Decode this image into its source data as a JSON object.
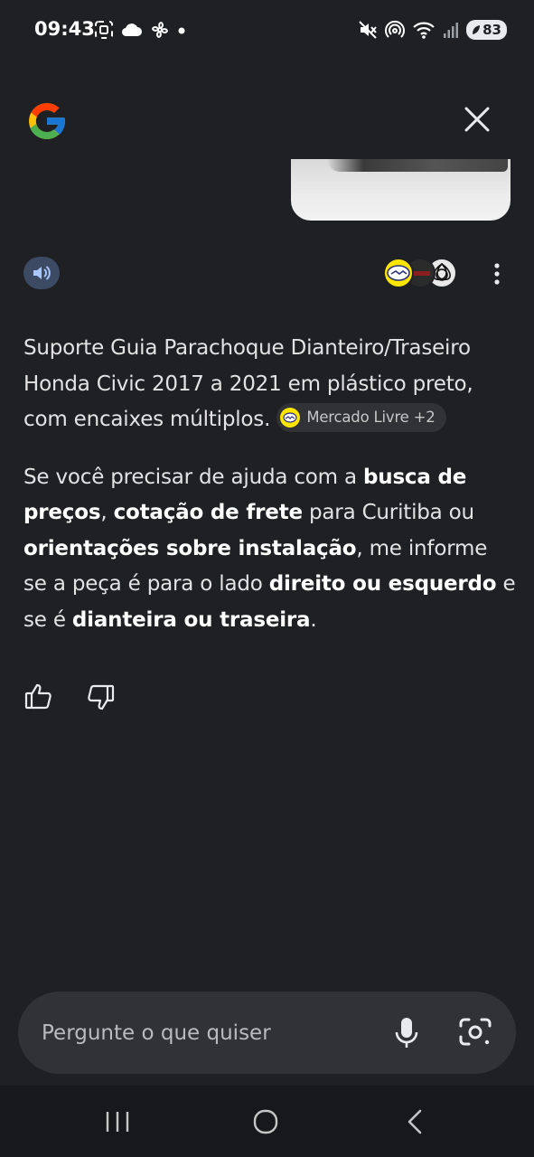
{
  "status_bar": {
    "time": "09:43",
    "battery": "83",
    "left_icons": [
      "screenshot-icon",
      "cloud-icon",
      "fan-icon",
      "dot-icon"
    ],
    "right_icons": [
      "mute-icon",
      "hotspot-icon",
      "wifi-icon",
      "signal-icon",
      "battery-icon"
    ]
  },
  "header": {
    "logo": "google-logo",
    "close_icon": "close-icon"
  },
  "toolbar": {
    "speaker_icon": "speaker-icon",
    "sources": [
      "mercado-livre-avatar",
      "dark-avatar",
      "triquetra-avatar"
    ],
    "more_icon": "more-vert-icon"
  },
  "answer": {
    "p1_text": "Suporte Guia Parachoque Dianteiro/Traseiro Honda Civic 2017 a 2021 em plástico preto, com encaixes múltiplos.",
    "chip_label": "Mercado Livre +2",
    "p2_a": "Se você precisar de ajuda com a ",
    "p2_b1": "busca de preços",
    "p2_c": ", ",
    "p2_b2": "cotação de frete",
    "p2_d": " para Curitiba ou ",
    "p2_b3": "orientações sobre instalação",
    "p2_e": ", me informe se a peça é para o lado ",
    "p2_b4": "direito ou esquerdo",
    "p2_f": " e se é ",
    "p2_b5": "dianteira ou traseira",
    "p2_g": "."
  },
  "feedback": {
    "up_icon": "thumbs-up-icon",
    "down_icon": "thumbs-down-icon"
  },
  "ask": {
    "placeholder": "Pergunte o que quiser",
    "value": "",
    "mic_icon": "mic-icon",
    "lens_icon": "camera-lens-icon"
  },
  "colors": {
    "background": "#1f2024",
    "surface": "#303236",
    "speaker_bg": "#3c4a63",
    "text": "#e3e3e3"
  }
}
